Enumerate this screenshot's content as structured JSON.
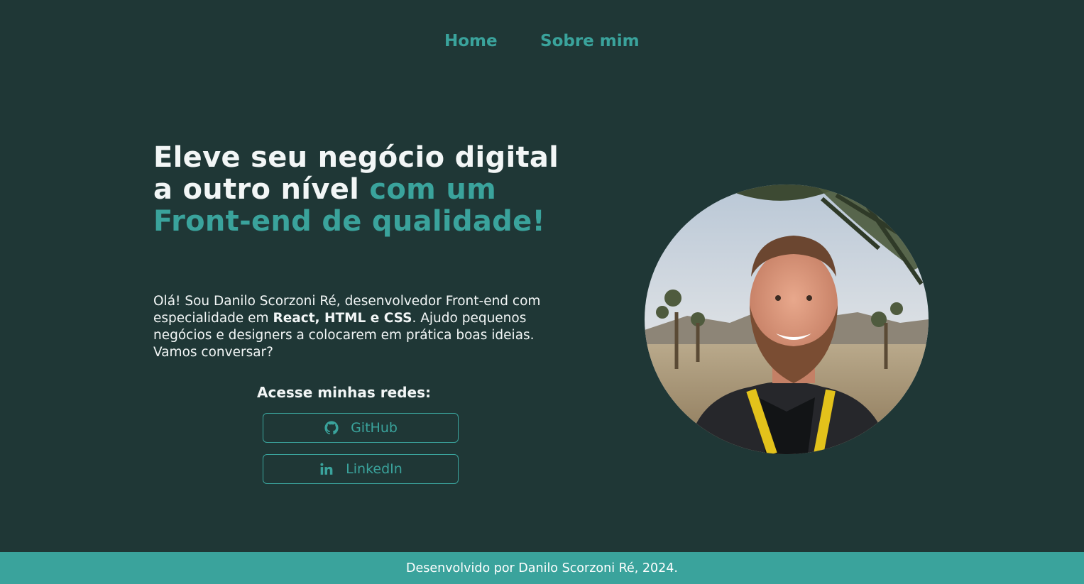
{
  "nav": {
    "home_label": "Home",
    "about_label": "Sobre mim"
  },
  "hero": {
    "headline_plain": "Eleve seu negócio digital a outro nível ",
    "headline_accent": "com um Front-end de qualidade!",
    "intro_before": "Olá! Sou Danilo Scorzoni Ré, desenvolvedor Front-end com especialidade em ",
    "intro_bold": "React, HTML e CSS",
    "intro_after": ". Ajudo pequenos negócios e designers a colocarem em prática boas ideias. Vamos conversar?",
    "photo_icon": "profile-photo"
  },
  "social": {
    "title": "Acesse minhas redes:",
    "github_label": "GitHub",
    "github_icon": "github-icon",
    "linkedin_label": "LinkedIn",
    "linkedin_icon": "linkedin-icon"
  },
  "footer": {
    "text": "Desenvolvido por Danilo Scorzoni Ré, 2024."
  },
  "colors": {
    "background": "#1f3736",
    "accent": "#3aa39c",
    "text": "#f2f6f6",
    "footer_bg": "#3aa39c"
  }
}
